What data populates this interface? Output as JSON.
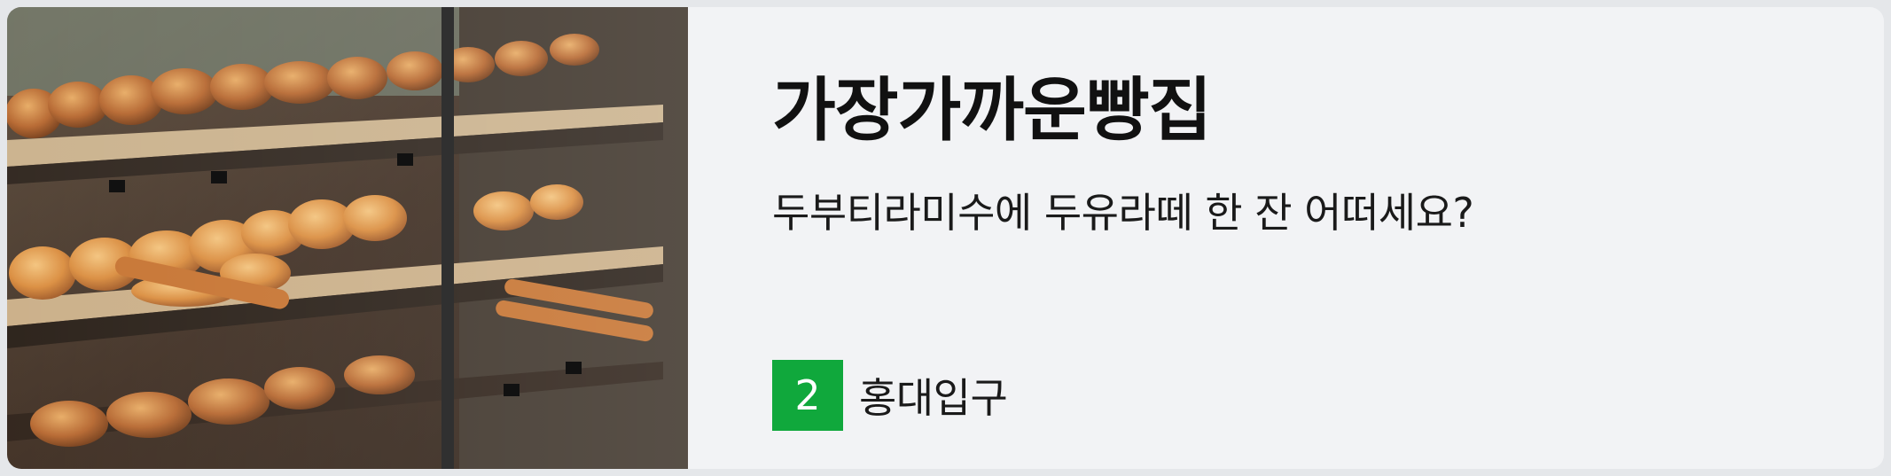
{
  "card": {
    "title": "가장가까운빵집",
    "subtitle": "두부티라미수에 두유라떼 한 잔 어떠세요?",
    "station": {
      "line": "2",
      "line_color": "#10a83c",
      "name": "홍대입구"
    },
    "image": {
      "icon": "bakery-display-case-photo"
    }
  }
}
